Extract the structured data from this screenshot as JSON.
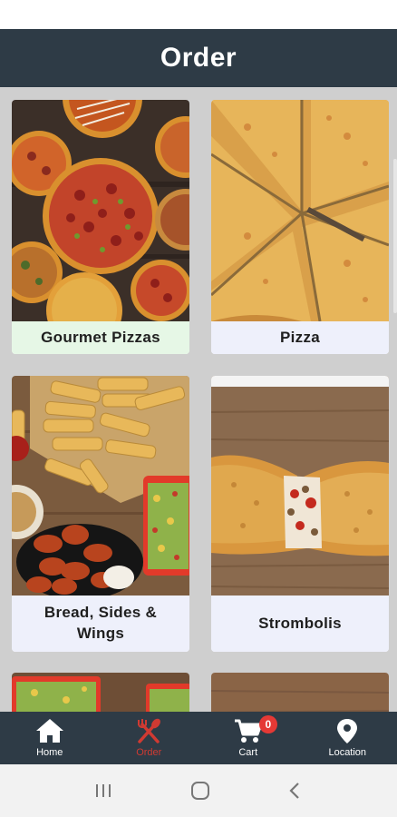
{
  "header": {
    "title": "Order"
  },
  "categories": [
    {
      "label": "Gourmet Pizzas",
      "label_bg": "#e6f7e6"
    },
    {
      "label": "Pizza",
      "label_bg": "#eef0fb"
    },
    {
      "label": "Bread, Sides & Wings",
      "label_bg": "#eef0fb"
    },
    {
      "label": "Strombolis",
      "label_bg": "#eef0fb"
    }
  ],
  "bottom_nav": {
    "active": "Order",
    "items": [
      {
        "label": "Home",
        "icon": "home-icon"
      },
      {
        "label": "Order",
        "icon": "utensils-icon"
      },
      {
        "label": "Cart",
        "icon": "cart-icon",
        "badge": "0"
      },
      {
        "label": "Location",
        "icon": "location-pin-icon"
      }
    ]
  },
  "system_nav": {
    "icons": [
      "recent-apps-icon",
      "home-circle-icon",
      "back-icon"
    ]
  },
  "colors": {
    "header_bg": "#2e3b46",
    "accent_active": "#d03a32",
    "badge": "#e53935",
    "content_bg": "#cfcfcf"
  }
}
